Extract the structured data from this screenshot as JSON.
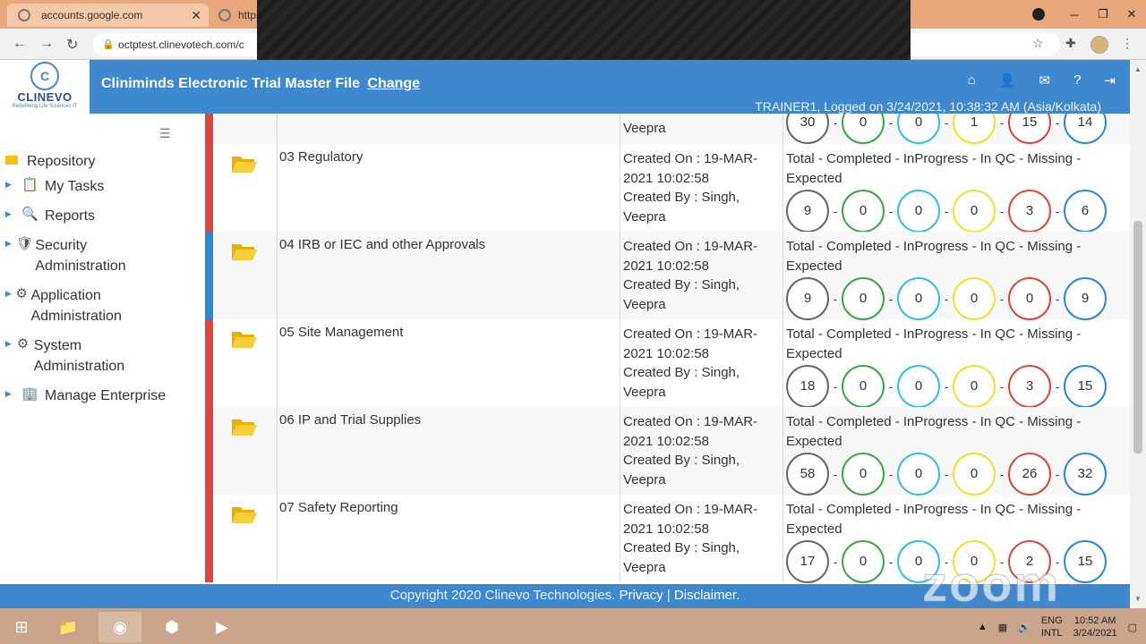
{
  "browser": {
    "tabs": [
      {
        "title": "accounts.google.com"
      },
      {
        "title": "https"
      }
    ],
    "url": "octptest.clinevotech.com/c"
  },
  "app": {
    "logo_text": "CLINEVO",
    "logo_letter": "C",
    "logo_tagline": "Redefining Life Sciences IT",
    "title": "Cliniminds Electronic Trial Master File",
    "change_link": "Change",
    "logged_on": "TRAINER1, Logged on 3/24/2021, 10:38:32 AM (Asia/Kolkata)",
    "header_icons": [
      "home-icon",
      "user-icon",
      "mail-icon",
      "help-icon",
      "logout-icon"
    ]
  },
  "sidebar": {
    "root": "Repository",
    "items": [
      {
        "label": "My Tasks",
        "icon": "tasks-icon"
      },
      {
        "label": "Reports",
        "icon": "reports-icon"
      },
      {
        "label": "Security Administration",
        "icon": "security-icon"
      },
      {
        "label": "Application Administration",
        "icon": "application-icon"
      },
      {
        "label": "System Administration",
        "icon": "system-icon"
      },
      {
        "label": "Manage Enterprise",
        "icon": "enterprise-icon"
      }
    ]
  },
  "table": {
    "stats_header": "Total  - Completed - InProgress - In QC  - Missing - Expected",
    "partial_row": {
      "meta_tail": "Veepra",
      "stats": [
        "30",
        "0",
        "0",
        "1",
        "15",
        "14"
      ]
    },
    "rows": [
      {
        "name": "03 Regulatory",
        "created_on": "Created On : 19-MAR-2021 10:02:58",
        "created_by": "Created By : Singh, Veepra",
        "stripe": "#e0443a",
        "stats": [
          "9",
          "0",
          "0",
          "0",
          "3",
          "6"
        ]
      },
      {
        "name": "04 IRB or IEC and other Approvals",
        "created_on": "Created On : 19-MAR-2021 10:02:58",
        "created_by": "Created By : Singh, Veepra",
        "stripe": "#2b88d8",
        "stats": [
          "9",
          "0",
          "0",
          "0",
          "0",
          "9"
        ]
      },
      {
        "name": "05 Site Management",
        "created_on": "Created On : 19-MAR-2021 10:02:58",
        "created_by": "Created By : Singh, Veepra",
        "stripe": "#e0443a",
        "stats": [
          "18",
          "0",
          "0",
          "0",
          "3",
          "15"
        ]
      },
      {
        "name": "06 IP and Trial Supplies",
        "created_on": "Created On : 19-MAR-2021 10:02:58",
        "created_by": "Created By : Singh, Veepra",
        "stripe": "#e0443a",
        "stats": [
          "58",
          "0",
          "0",
          "0",
          "26",
          "32"
        ]
      },
      {
        "name": "07 Safety Reporting",
        "created_on": "Created On : 19-MAR-2021 10:02:58",
        "created_by": "Created By : Singh, Veepra",
        "stripe": "#e0443a",
        "stats": [
          "17",
          "0",
          "0",
          "0",
          "2",
          "15"
        ]
      }
    ]
  },
  "footer": {
    "copyright": "Copyright 2020 Clinevo Technologies.",
    "privacy": "Privacy",
    "separator": "|",
    "disclaimer": "Disclaimer."
  },
  "watermark": "zoom",
  "taskbar": {
    "lang_top": "ENG",
    "lang_bottom": "INTL",
    "time": "10:52 AM",
    "date": "3/24/2021"
  }
}
